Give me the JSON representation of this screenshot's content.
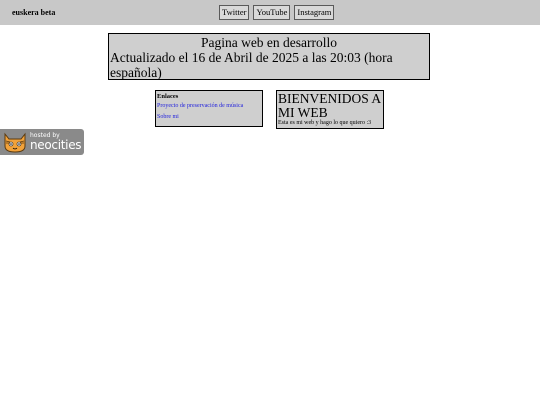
{
  "header": {
    "brand": "euskera beta",
    "social": [
      "Twitter",
      "YouTube",
      "Instagram"
    ]
  },
  "banner": {
    "line1": "Pagina web en desarrollo",
    "line2": "Actualizado el 16 de Abril de 2025 a las 20:03 (hora española)"
  },
  "links_box": {
    "heading": "Enlaces",
    "items": [
      "Proyecto de preservación de música",
      "Sobre mi"
    ]
  },
  "welcome_box": {
    "title": "BIENVENIDOS A MI WEB",
    "subtitle": "Esta es mi web y hago lo que quiero :3"
  },
  "hosted_badge": {
    "hosted_by": "hosted by",
    "name": "neocities"
  },
  "colors": {
    "topbar": "#c8c8c8",
    "box": "#cfcfcf",
    "link": "#2222dd",
    "badge": "#8a8a8a"
  }
}
